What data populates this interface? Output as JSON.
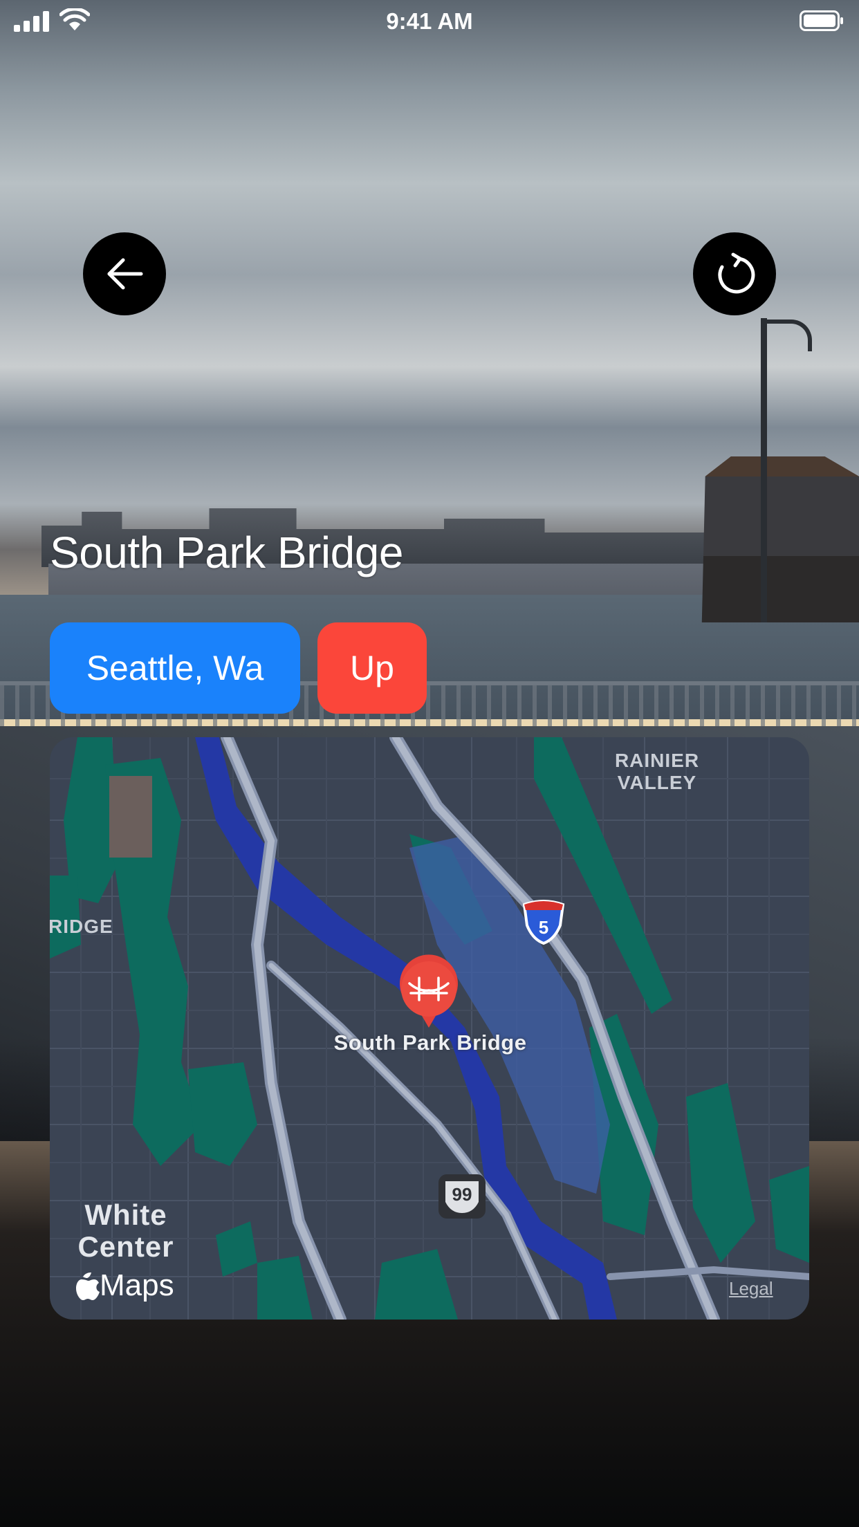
{
  "status_bar": {
    "time": "9:41 AM",
    "icons": [
      "cellular-signal-icon",
      "wifi-icon",
      "battery-icon"
    ]
  },
  "header": {
    "back_icon": "arrow-left-icon",
    "refresh_icon": "refresh-icon"
  },
  "bridge": {
    "name": "South Park Bridge",
    "location": "Seattle, Wa",
    "status": "Up"
  },
  "colors": {
    "location_pill": "#1a82fb",
    "status_pill": "#fb463a",
    "map_background": "#3b4454",
    "button_background": "#000000"
  },
  "map": {
    "labels": {
      "neighborhood_top_right": "RAINIER\nVALLEY",
      "neighborhood_left": "RIDGE",
      "neighborhood_bottom_left": "White\nCenter"
    },
    "pin_label": "South Park Bridge",
    "pin_icon": "bridge-icon",
    "interstate_shield": "5",
    "highway_shield": "99",
    "brand": "Maps",
    "brand_icon": "apple-logo-icon",
    "legal": "Legal"
  }
}
